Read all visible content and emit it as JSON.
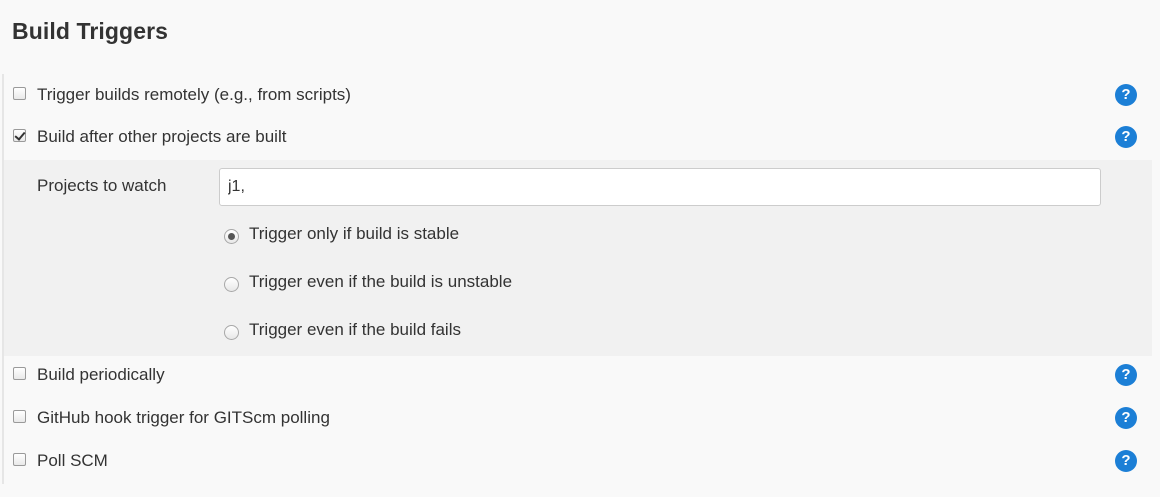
{
  "section": {
    "title": "Build Triggers"
  },
  "triggers": [
    {
      "label": "Trigger builds remotely (e.g., from scripts)",
      "checked": false,
      "help_icon": "help-question-icon"
    },
    {
      "label": "Build after other projects are built",
      "checked": true,
      "help_icon": "help-question-icon"
    },
    {
      "label": "Build periodically",
      "checked": false,
      "help_icon": "help-question-icon"
    },
    {
      "label": "GitHub hook trigger for GITScm polling",
      "checked": false,
      "help_icon": "help-question-icon"
    },
    {
      "label": "Poll SCM",
      "checked": false,
      "help_icon": "help-question-icon"
    }
  ],
  "help": {
    "glyph": "?",
    "color": "#1c7fd6"
  },
  "build_after": {
    "projects_label": "Projects to watch",
    "projects_value": "j1,",
    "options": [
      {
        "label": "Trigger only if build is stable",
        "selected": true
      },
      {
        "label": "Trigger even if the build is unstable",
        "selected": false
      },
      {
        "label": "Trigger even if the build fails",
        "selected": false
      }
    ]
  }
}
